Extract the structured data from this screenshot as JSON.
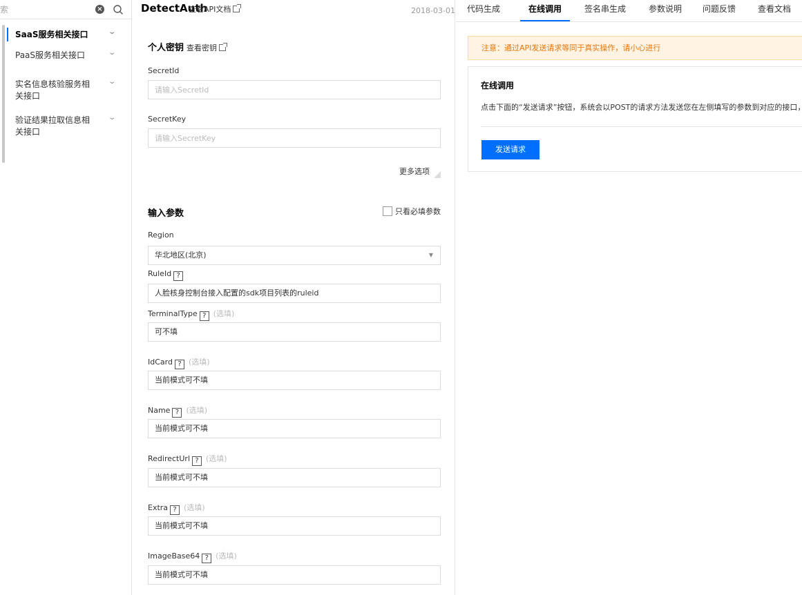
{
  "sidebar": {
    "search_placeholder": "索",
    "clear_icon": "clear-icon",
    "search_icon": "search-icon",
    "items": [
      {
        "label": "SaaS服务相关接口",
        "active": true
      },
      {
        "label": "PaaS服务相关接口",
        "active": false
      },
      {
        "label": "实名信息核验服务相关接口",
        "active": false
      },
      {
        "label": "验证结果拉取信息相关接口",
        "active": false
      }
    ]
  },
  "api": {
    "title": "DetectAuth",
    "doc_link": "查看API文档",
    "date": "2018-03-01"
  },
  "secret": {
    "title": "个人密钥",
    "view_link": "查看密钥",
    "secret_id_label": "SecretId",
    "secret_id_placeholder": "请输入SecretId",
    "secret_key_label": "SecretKey",
    "secret_key_placeholder": "请输入SecretKey",
    "more_options": "更多选项"
  },
  "params": {
    "title": "输入参数",
    "required_only_label": "只看必填参数",
    "optional_tag": "(选填)",
    "help_glyph": "?",
    "region_label": "Region",
    "region_value": "华北地区(北京)",
    "fields": [
      {
        "label": "RuleId",
        "optional": false,
        "value": "人脸核身控制台接入配置的sdk项目列表的ruleid"
      },
      {
        "label": "TerminalType",
        "optional": true,
        "value": "可不填"
      },
      {
        "label": "IdCard",
        "optional": true,
        "value": "当前模式可不填"
      },
      {
        "label": "Name",
        "optional": true,
        "value": "当前模式可不填"
      },
      {
        "label": "RedirectUrl",
        "optional": true,
        "value": "当前模式可不填"
      },
      {
        "label": "Extra",
        "optional": true,
        "value": "当前模式可不填"
      },
      {
        "label": "ImageBase64",
        "optional": true,
        "value": "当前模式可不填"
      }
    ]
  },
  "tabs": [
    {
      "label": "代码生成",
      "active": false
    },
    {
      "label": "在线调用",
      "active": true
    },
    {
      "label": "签名串生成",
      "active": false
    },
    {
      "label": "参数说明",
      "active": false
    },
    {
      "label": "问题反馈",
      "active": false
    },
    {
      "label": "查看文档",
      "active": false
    }
  ],
  "invoke": {
    "warning": "注意：通过API发送请求等同于真实操作，请小心进行",
    "title": "在线调用",
    "description": "点击下面的“发送请求”按钮，系统会以POST的请求方法发送您在左侧填写的参数到对应的接口，",
    "send_button": "发送请求"
  },
  "colors": {
    "accent": "#006eff",
    "warning_bg": "#fff4e3",
    "warning_text": "#e5760b"
  }
}
